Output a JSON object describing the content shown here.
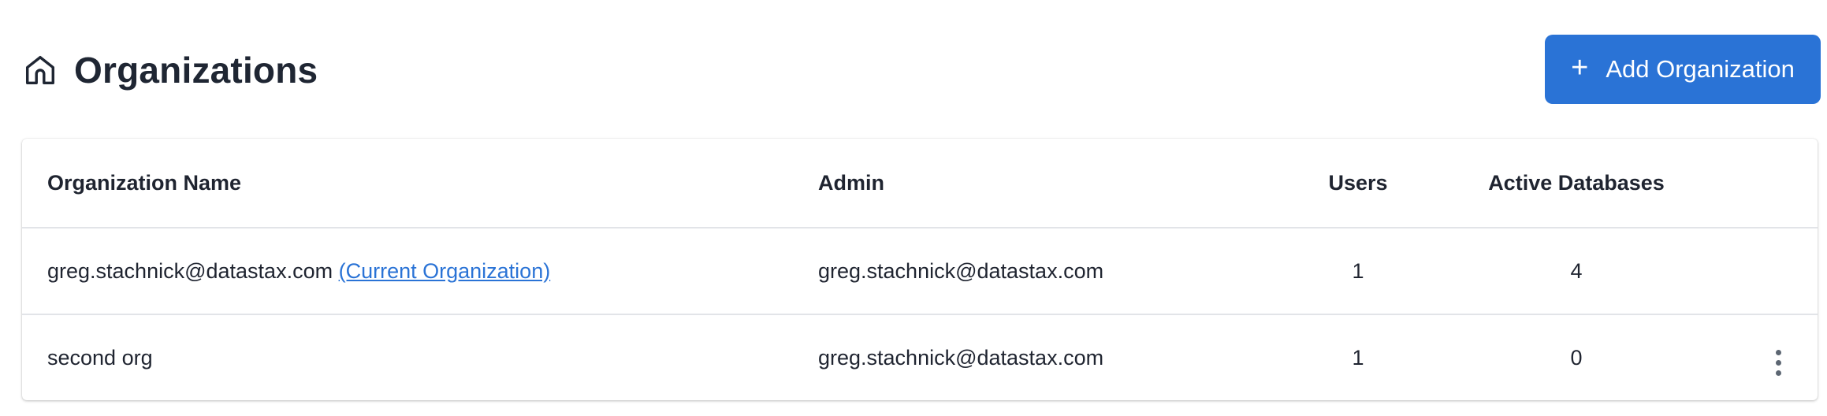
{
  "header": {
    "title": "Organizations",
    "title_icon": "home-icon",
    "add_button_label": "Add Organization",
    "add_button_icon": "plus-icon",
    "accent_color": "#2a73d6"
  },
  "table": {
    "columns": [
      "Organization Name",
      "Admin",
      "Users",
      "Active Databases"
    ],
    "rows": [
      {
        "name": "greg.stachnick@datastax.com",
        "current_label": "(Current Organization)",
        "admin": "greg.stachnick@datastax.com",
        "users": "1",
        "active_databases": "4",
        "has_actions": false
      },
      {
        "name": "second org",
        "current_label": "",
        "admin": "greg.stachnick@datastax.com",
        "users": "1",
        "active_databases": "0",
        "has_actions": true,
        "actions_icon": "more-vertical-icon"
      }
    ]
  }
}
